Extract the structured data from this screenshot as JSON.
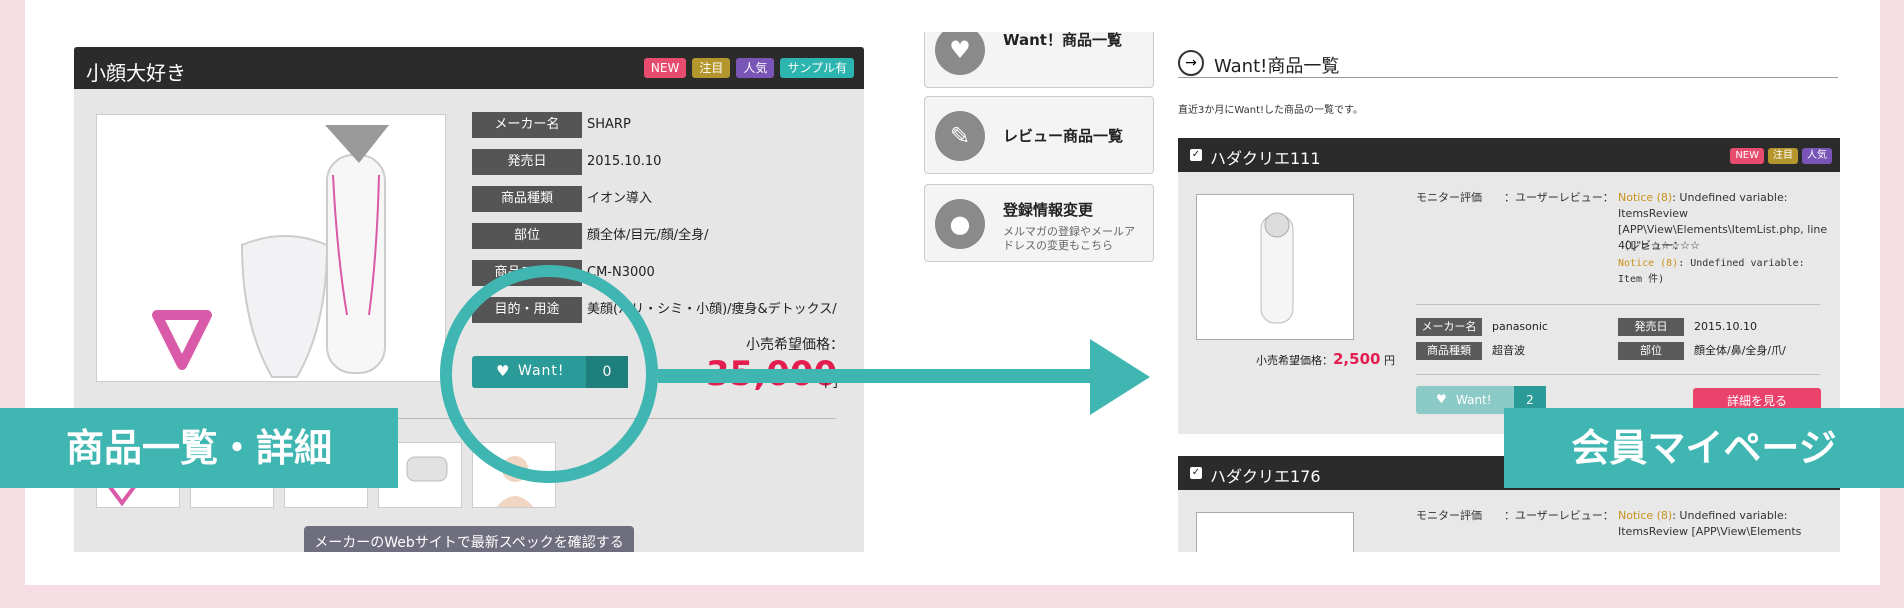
{
  "left": {
    "title": "小顔大好き",
    "badges": [
      "NEW",
      "注目",
      "人気",
      "サンプル有"
    ],
    "specs": [
      {
        "label": "メーカー名",
        "value": "SHARP"
      },
      {
        "label": "発売日",
        "value": "2015.10.10"
      },
      {
        "label": "商品種類",
        "value": "イオン導入"
      },
      {
        "label": "部位",
        "value": "顔全体/目元/顔/全身/"
      },
      {
        "label": "商品コード",
        "value": "CM-N3000"
      },
      {
        "label": "目的・用途",
        "value": "美顔(ハリ・シミ・小顔)/痩身&デトックス/"
      }
    ],
    "price_label": "小売希望価格：",
    "price": "35,000",
    "price_unit": "円",
    "want_label": "Want!",
    "want_count": "0",
    "spec_button": "メーカーのWebサイトで最新スペックを確認する"
  },
  "right": {
    "side_cards": [
      {
        "title": "Want！商品一覧",
        "sub": "",
        "icon": "heart-icon"
      },
      {
        "title": "レビュー商品一覧",
        "sub": "",
        "icon": "pencil-icon"
      },
      {
        "title": "登録情報変更",
        "sub": "メルマガの登録やメールアドレスの変更もこちら",
        "icon": "user-icon"
      }
    ],
    "section_title": "Want!商品一覧",
    "intro": "直近3か月にWant!した商品の一覧です。",
    "items": [
      {
        "name": "ハダクリエ111",
        "badges": [
          "NEW",
          "注目",
          "人気"
        ],
        "monitor_label": "モニター評価",
        "review_label": "：ユーザーレビュー：",
        "notice1": "Notice (8)",
        "notice1_rest": ": Undefined variable: ItemsReview [APP\\View\\Elements\\ItemList.php, line 40]\">☆☆☆☆☆",
        "review_paren": "（レビュー：",
        "notice2": "Notice (8)",
        "notice2_rest": ": Undefined variable: Item 件)",
        "maker_label": "メーカー名",
        "maker": "panasonic",
        "release_label": "発売日",
        "release": "2015.10.10",
        "type_label": "商品種類",
        "type": "超音波",
        "part_label": "部位",
        "part": "顔全体/鼻/全身/爪/",
        "price_label": "小売希望価格：",
        "price": "2,500",
        "price_unit": "円",
        "want_label": "Want!",
        "want_count": "2",
        "detail_label": "詳細を見る"
      },
      {
        "name": "ハダクリエ176",
        "monitor_label": "モニター評価",
        "review_label": "：ユーザーレビュー：",
        "notice1": "Notice (8)",
        "notice1_rest": ": Undefined variable: ItemsReview [APP\\View\\Elements"
      }
    ]
  },
  "overlay": {
    "left_label": "商品一覧・詳細",
    "right_label": "会員マイページ"
  },
  "colors": {
    "accent": "#3fb6b1",
    "price": "#e31e4f",
    "bg_pink": "#f6dde3"
  }
}
